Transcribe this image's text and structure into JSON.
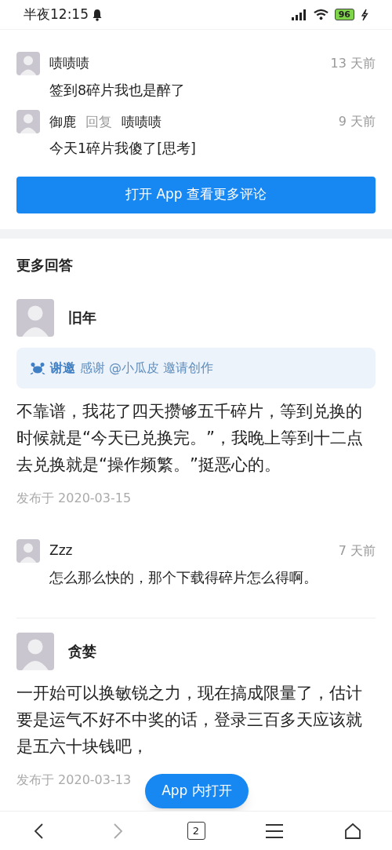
{
  "status_bar": {
    "time": "半夜12:15",
    "battery": "96"
  },
  "comments": [
    {
      "user": "啧啧啧",
      "time": "13 天前",
      "text": "签到8碎片我也是醉了"
    },
    {
      "user": "御鹿",
      "reply_label": "回复",
      "reply_to": "啧啧啧",
      "time": "9 天前",
      "text": "今天1碎片我傻了[思考]"
    }
  ],
  "more_comments_button": "打开 App 查看更多评论",
  "section_title": "更多回答",
  "answers": [
    {
      "user": "旧年",
      "invite": {
        "label": "谢邀",
        "text": "感谢 @小瓜皮 邀请创作"
      },
      "body": "不靠谱，我花了四天攒够五千碎片，等到兑换的时候就是“今天已兑换完。”，我晚上等到十二点去兑换就是“操作频繁。”挺恶心的。",
      "date": "发布于 2020-03-15",
      "comments": [
        {
          "user": "Zzz",
          "time": "7 天前",
          "text": "怎么那么快的，那个下载得碎片怎么得啊。"
        }
      ]
    },
    {
      "user": "贪婪",
      "body": "一开始可以换敏锐之力，现在搞成限量了，估计要是运气不好不中奖的话，登录三百多天应该就是五六十块钱吧，",
      "date": "发布于 2020-03-13"
    }
  ],
  "float_button": "App 内打开",
  "bottom_nav": {
    "tab_count": "2"
  }
}
